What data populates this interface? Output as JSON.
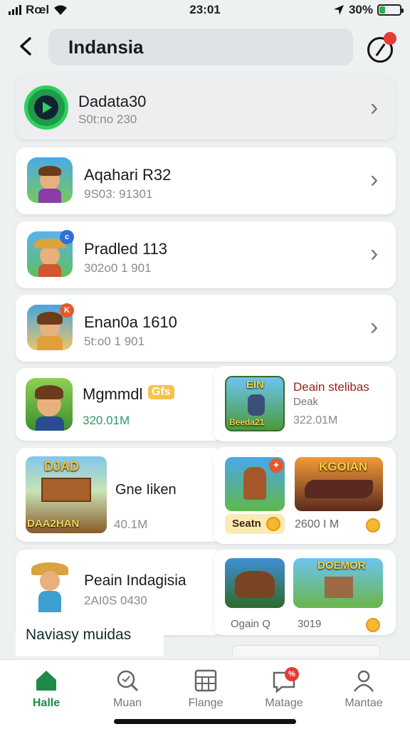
{
  "status_bar": {
    "carrier": "Rœl",
    "time": "23:01",
    "battery": "30%",
    "battery_level": 0.3
  },
  "header": {
    "search_value": "Indansia",
    "notification_badge": ""
  },
  "rows": [
    {
      "title": "Dadata30",
      "subtitle": "S0t:no 230"
    },
    {
      "title": "Aqahari R32",
      "subtitle": "9S03: 91301"
    },
    {
      "title": "Pradled 113",
      "subtitle": "302o0 1 901"
    },
    {
      "title": "Enan0a 1610",
      "subtitle": "5t:o0 1 901"
    }
  ],
  "featured": [
    {
      "title": "Mgmmdl",
      "tag": "Gfs",
      "subtitle": "320.01M"
    },
    {
      "title": "Gne Iiken",
      "subtitle": "40.1M",
      "banner_top": "DJAD",
      "banner_bottom": "DAA2HAN"
    },
    {
      "title": "Peain Indagisia",
      "subtitle": "2AI0S 0430"
    }
  ],
  "promo": {
    "title": "Deain stelibas",
    "subtitle": "Deak",
    "size": "322.01M",
    "banner_top": "EIN",
    "banner_bottom": "Beeda21"
  },
  "tiles": [
    {
      "label": "Seatn",
      "badge": ""
    },
    {
      "label": "2600 I M",
      "banner": "KGOIAN"
    },
    {
      "label": "Ogain Q",
      "badge": ""
    },
    {
      "label": "3019",
      "banner": "DOEMOR"
    }
  ],
  "section_header": "Naviasy muidas",
  "nav": [
    {
      "label": "Halle",
      "icon": "home-icon",
      "active": true
    },
    {
      "label": "Muan",
      "icon": "search-icon",
      "active": false
    },
    {
      "label": "Flange",
      "icon": "grid-icon",
      "active": false
    },
    {
      "label": "Matage",
      "icon": "message-icon",
      "active": false
    },
    {
      "label": "Mantae",
      "icon": "profile-icon",
      "active": false
    }
  ],
  "colors": {
    "accent": "#1e8a48",
    "badge_red": "#e53b33",
    "promo_title": "#9a1d1d",
    "size_green": "#2a9a63"
  }
}
